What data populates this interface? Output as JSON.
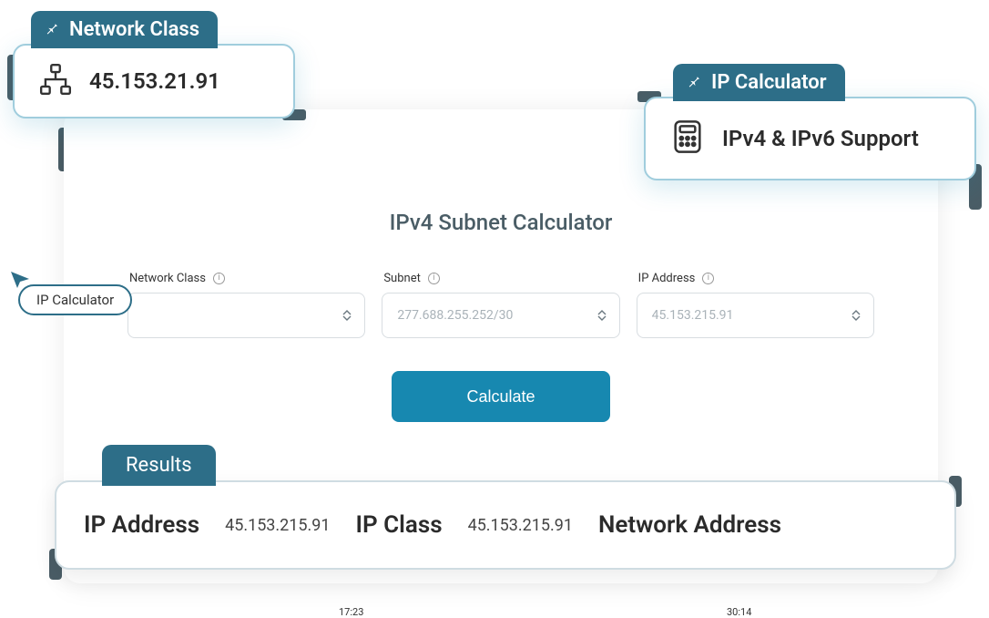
{
  "main": {
    "title": "IPv4 Subnet Calculator",
    "fields": {
      "network_class_label": "Network Class",
      "subnet_label": "Subnet",
      "subnet_value": "277.688.255.252/30",
      "ip_label": "IP Address",
      "ip_value": "45.153.215.91"
    },
    "calculate_label": "Calculate"
  },
  "callouts": {
    "network_class": {
      "tab": "Network Class",
      "value": "45.153.21.91"
    },
    "ip_calc": {
      "tab": "IP Calculator",
      "value": "IPv4 & IPv6 Support"
    },
    "pill": "IP Calculator"
  },
  "results": {
    "tab": "Results",
    "ip_address_label": "IP Address",
    "ip_address_value": "45.153.215.91",
    "ip_class_label": "IP Class",
    "ip_class_value": "45.153.215.91",
    "network_address_label": "Network Address"
  },
  "timestamps": {
    "left": "17:23",
    "right": "30:14"
  }
}
